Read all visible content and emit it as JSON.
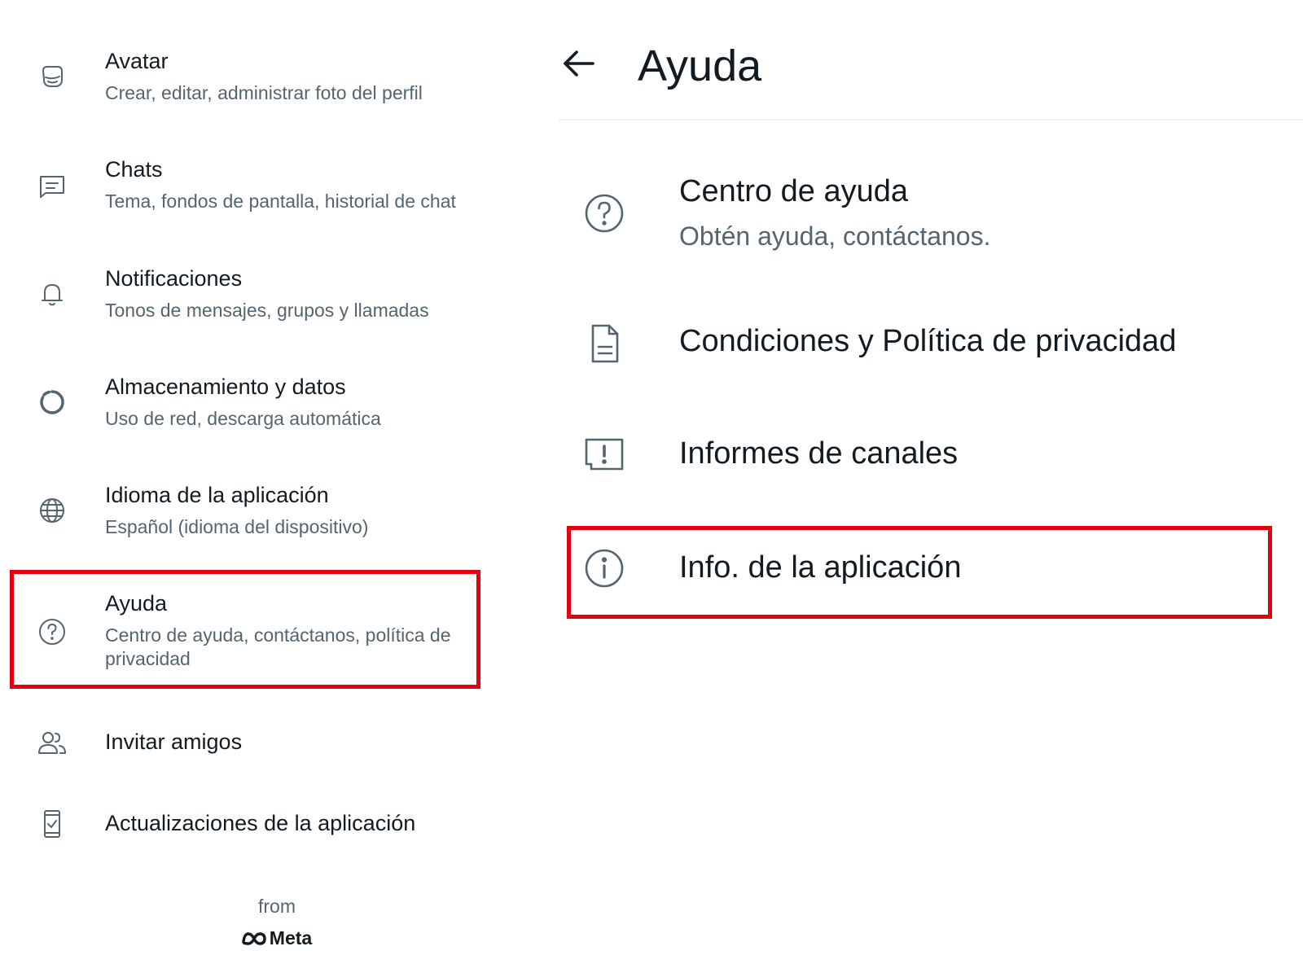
{
  "settings_list": {
    "items": [
      {
        "icon": "avatar-icon",
        "title": "Avatar",
        "subtitle": "Crear, editar, administrar foto del perfil"
      },
      {
        "icon": "chat-icon",
        "title": "Chats",
        "subtitle": "Tema, fondos de pantalla, historial de chat"
      },
      {
        "icon": "bell-icon",
        "title": "Notificaciones",
        "subtitle": "Tonos de mensajes, grupos y llamadas"
      },
      {
        "icon": "storage-icon",
        "title": "Almacenamiento y datos",
        "subtitle": "Uso de red, descarga automática"
      },
      {
        "icon": "globe-icon",
        "title": "Idioma de la aplicación",
        "subtitle": "Español (idioma del dispositivo)"
      },
      {
        "icon": "help-icon",
        "title": "Ayuda",
        "subtitle": "Centro de ayuda, contáctanos, política de privacidad",
        "highlighted": true
      },
      {
        "icon": "invite-friends-icon",
        "title": "Invitar amigos"
      },
      {
        "icon": "app-updates-icon",
        "title": "Actualizaciones de la aplicación"
      }
    ]
  },
  "footer": {
    "from_label": "from",
    "brand": "Meta",
    "brand_icon": "meta-logo-icon"
  },
  "help_screen": {
    "back_icon": "arrow-left-icon",
    "title": "Ayuda",
    "items": [
      {
        "icon": "question-circle-icon",
        "title": "Centro de ayuda",
        "subtitle": "Obtén ayuda, contáctanos."
      },
      {
        "icon": "document-icon",
        "title": "Condiciones y Política de privacidad"
      },
      {
        "icon": "report-icon",
        "title": "Informes de canales"
      },
      {
        "icon": "info-icon",
        "title": "Info. de la aplicación",
        "highlighted": true
      }
    ]
  },
  "colors": {
    "primary_text": "#111b21",
    "secondary_text": "#54656f",
    "icon": "#54656f",
    "highlight_border": "#e3000f",
    "background": "#ffffff"
  }
}
